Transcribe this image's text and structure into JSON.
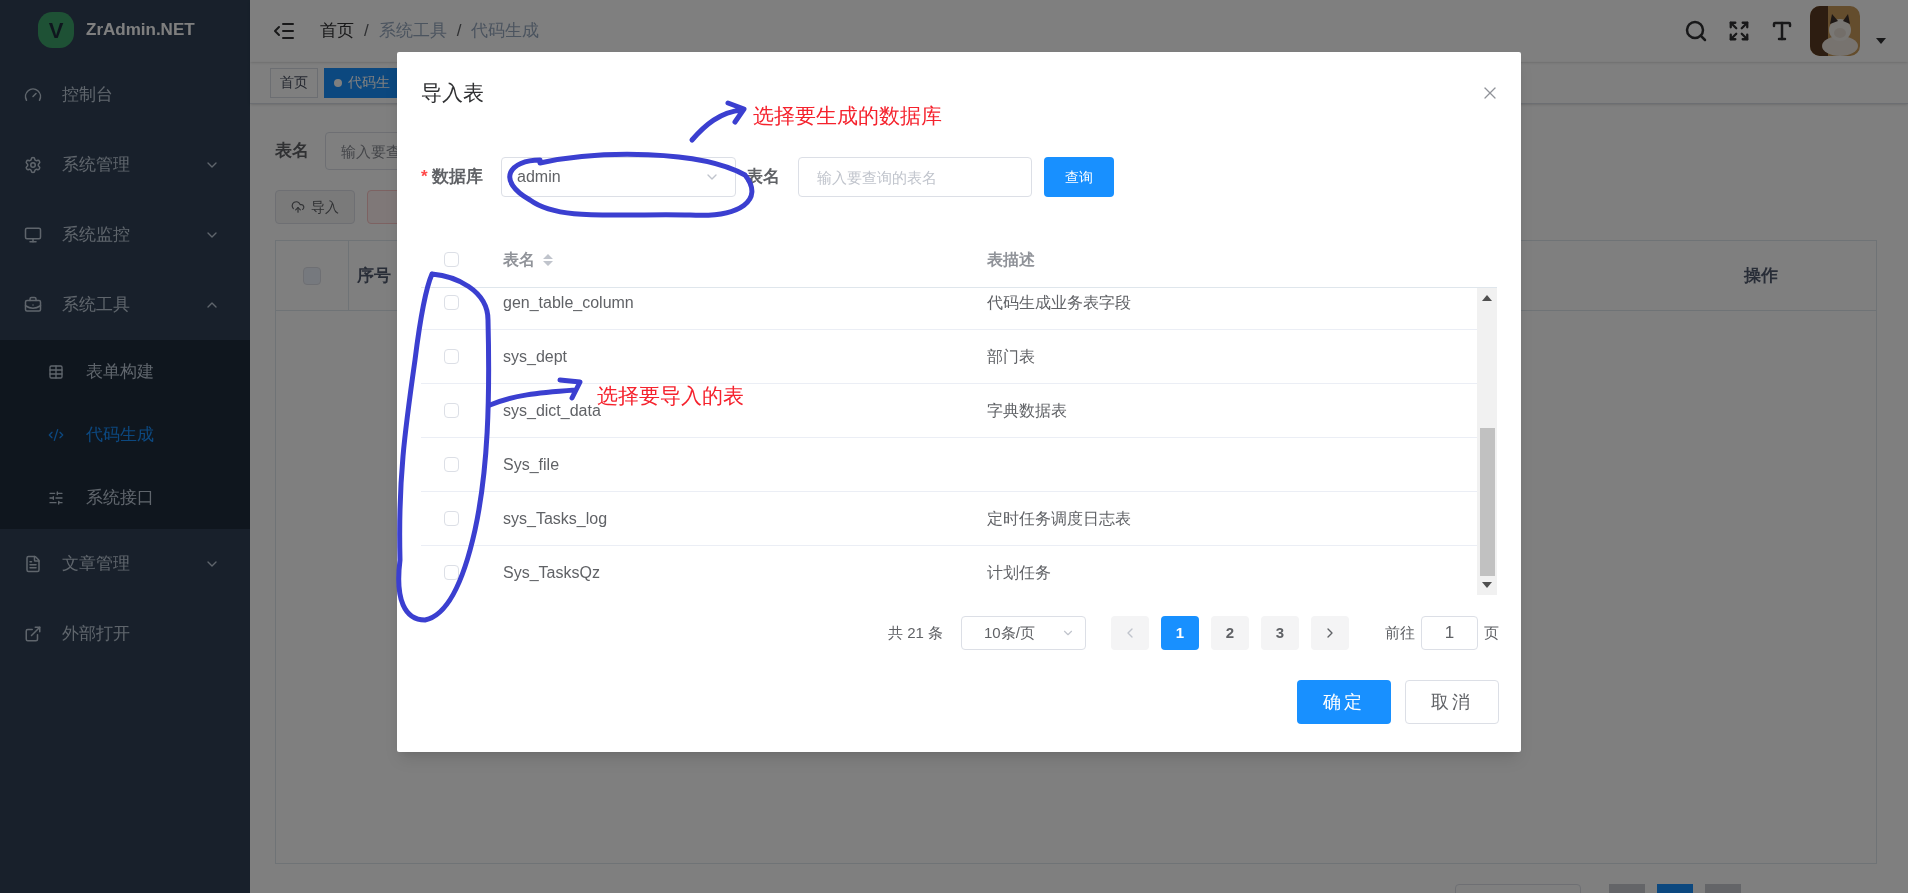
{
  "sidebar": {
    "logo": {
      "letter": "V",
      "title": "ZrAdmin.NET"
    },
    "items": [
      {
        "label": "控制台",
        "kind": "link"
      },
      {
        "label": "系统管理",
        "kind": "submenu",
        "expanded": false
      },
      {
        "label": "系统监控",
        "kind": "submenu",
        "expanded": false
      },
      {
        "label": "系统工具",
        "kind": "submenu",
        "expanded": true,
        "children": [
          {
            "label": "表单构建",
            "selected": false
          },
          {
            "label": "代码生成",
            "selected": true
          },
          {
            "label": "系统接口",
            "selected": false
          }
        ]
      },
      {
        "label": "文章管理",
        "kind": "submenu",
        "expanded": false
      },
      {
        "label": "外部打开",
        "kind": "link"
      }
    ]
  },
  "header": {
    "breadcrumb": [
      "首页",
      "系统工具",
      "代码生成"
    ],
    "separator": "/"
  },
  "tags": [
    {
      "label": "首页",
      "selected": false
    },
    {
      "label": "代码生",
      "selected": true
    }
  ],
  "page": {
    "search": {
      "label": "表名",
      "placeholder": "输入要查"
    },
    "buttons": [
      {
        "label": "导入",
        "kind": "plain"
      },
      {
        "kind": "danger"
      }
    ],
    "table": {
      "all_checked": false,
      "columns": [
        "序号",
        "操作"
      ]
    }
  },
  "dialog": {
    "title": "导入表",
    "form": {
      "database": {
        "label": "数据库",
        "required": true,
        "required_mark": "*",
        "value": "admin"
      },
      "table_name": {
        "label": "表名",
        "placeholder": "输入要查询的表名"
      },
      "query_button": "查询"
    },
    "table": {
      "all_checked": false,
      "columns": [
        {
          "label": "表名",
          "sortable": true
        },
        {
          "label": "表描述",
          "sortable": false
        }
      ],
      "rows": [
        {
          "name": "gen_table_column",
          "description": "代码生成业务表字段",
          "checked": false
        },
        {
          "name": "sys_dept",
          "description": "部门表",
          "checked": false
        },
        {
          "name": "sys_dict_data",
          "description": "字典数据表",
          "checked": false
        },
        {
          "name": "Sys_file",
          "checked": false
        },
        {
          "name": "sys_Tasks_log",
          "description": "定时任务调度日志表",
          "checked": false
        },
        {
          "name": "Sys_TasksQz",
          "description": "计划任务",
          "checked": false
        }
      ]
    },
    "pagination": {
      "total": "共 21 条",
      "page_size": "10条/页",
      "prev_disabled": true,
      "pages": [
        {
          "label": "1",
          "selected": true
        },
        {
          "label": "2",
          "selected": false
        },
        {
          "label": "3",
          "selected": false
        }
      ],
      "goto_label": "前往",
      "goto_value": "1",
      "goto_suffix": "页"
    },
    "buttons": [
      {
        "label": "确定",
        "kind": "primary"
      },
      {
        "label": "取消",
        "kind": "default"
      }
    ]
  },
  "annotations": [
    {
      "text": "选择要生成的数据库"
    },
    {
      "text": "选择要导入的表"
    }
  ]
}
